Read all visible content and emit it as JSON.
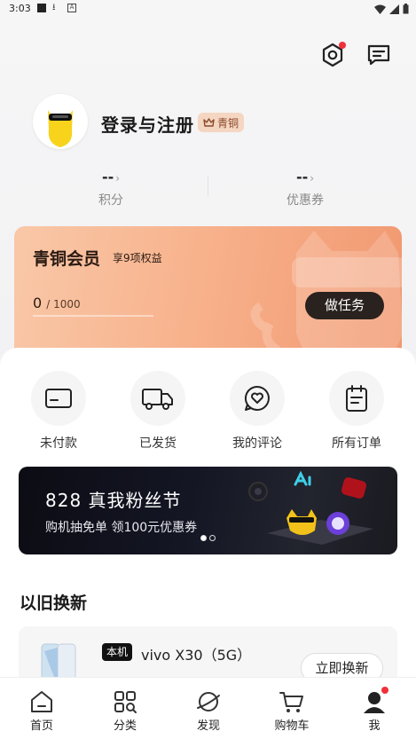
{
  "status_bar": {
    "time": "3:03"
  },
  "header": {
    "settings_icon": "settings-hexagon-icon",
    "messages_icon": "message-icon",
    "has_notification": true
  },
  "profile": {
    "title": "登录与注册",
    "tier": "青铜",
    "points": {
      "value": "--",
      "label": "积分"
    },
    "coupons": {
      "value": "--",
      "label": "优惠券"
    }
  },
  "membership": {
    "title": "青铜会员",
    "benefit": "享9项权益",
    "progress_current": "0",
    "progress_total": "/ 1000",
    "progress_fraction": 0,
    "task_button": "做任务"
  },
  "orders": [
    {
      "label": "未付款",
      "icon": "card-icon"
    },
    {
      "label": "已发货",
      "icon": "truck-icon"
    },
    {
      "label": "我的评论",
      "icon": "heart-chat-icon"
    },
    {
      "label": "所有订单",
      "icon": "clipboard-icon"
    }
  ],
  "banner": {
    "title": "828 真我粉丝节",
    "subtitle": "购机抽免单  领100元优惠券",
    "slide_count": 2,
    "active_slide": 1
  },
  "tradein": {
    "title": "以旧换新",
    "tag": "本机",
    "phone": "vivo X30（5G）",
    "button": "立即换新"
  },
  "nav": [
    {
      "label": "首页",
      "icon": "home-icon"
    },
    {
      "label": "分类",
      "icon": "category-icon"
    },
    {
      "label": "发现",
      "icon": "planet-icon"
    },
    {
      "label": "购物车",
      "icon": "cart-icon"
    },
    {
      "label": "我",
      "icon": "user-icon"
    }
  ],
  "colors": {
    "accent_red": "#f0303a",
    "card_orange": "#f7b08a",
    "dark": "#2a221e"
  }
}
